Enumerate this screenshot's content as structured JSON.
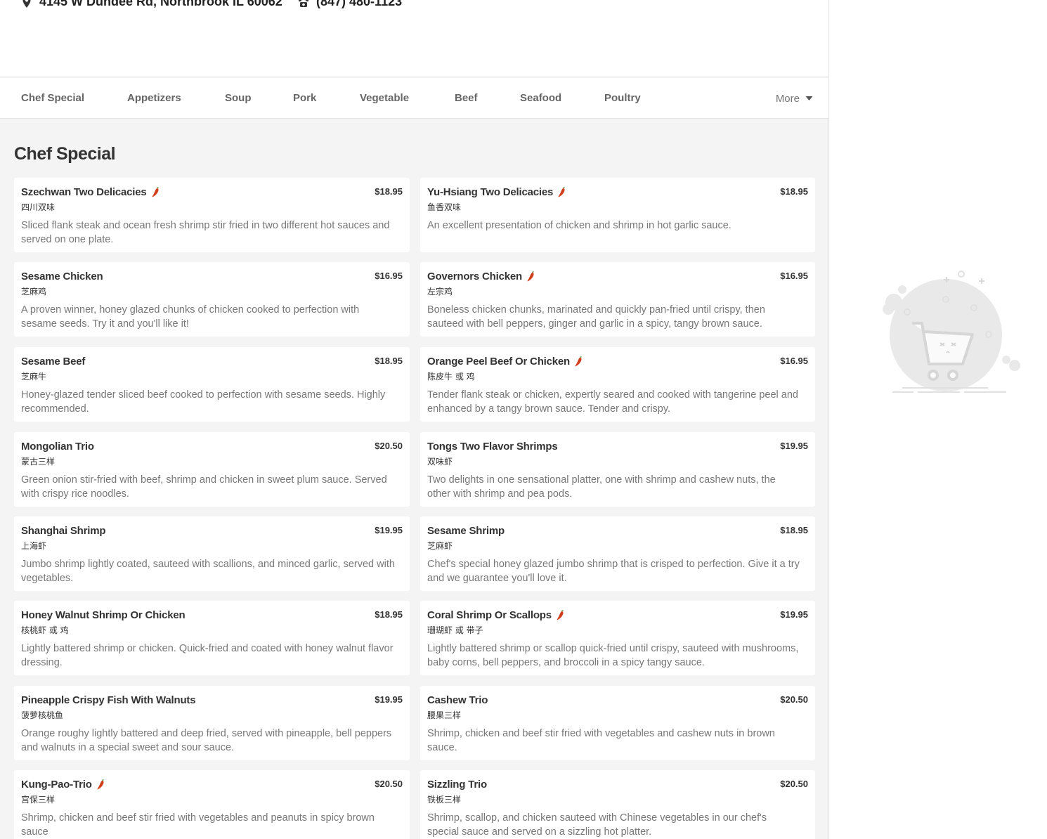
{
  "restaurant": {
    "address": "4145 W Dundee Rd, Northbrook IL 60062",
    "phone": "(847) 480-1123"
  },
  "nav": {
    "items": [
      "Chef Special",
      "Appetizers",
      "Soup",
      "Pork",
      "Vegetable",
      "Beef",
      "Seafood",
      "Poultry"
    ],
    "more_label": "More"
  },
  "section": {
    "title": "Chef Special"
  },
  "menu": [
    {
      "name": "Szechwan Two Delicacies",
      "cn": "四川双味",
      "price": "$18.95",
      "spicy": true,
      "desc": "Sliced flank steak and ocean fresh shrimp stir fried in two different hot sauces and served on one plate."
    },
    {
      "name": "Yu-Hsiang Two Delicacies",
      "cn": "鱼香双味",
      "price": "$18.95",
      "spicy": true,
      "desc": "An excellent presentation of chicken and shrimp in hot garlic sauce."
    },
    {
      "name": "Sesame Chicken",
      "cn": "芝麻鸡",
      "price": "$16.95",
      "spicy": false,
      "desc": "A proven winner, honey glazed chunks of chicken cooked to perfection with sesame seeds. Try it and you'll like it!"
    },
    {
      "name": "Governors Chicken",
      "cn": "左宗鸡",
      "price": "$16.95",
      "spicy": true,
      "desc": "Boneless chicken chunks, marinated and quickly pan-fried until crispy, then sauteed with bell peppers, ginger and garlic in a spicy, tangy brown sauce."
    },
    {
      "name": "Sesame Beef",
      "cn": "芝麻牛",
      "price": "$18.95",
      "spicy": false,
      "desc": "Honey-glazed tender sliced beef cooked to perfection with sesame seeds. Highly recommended."
    },
    {
      "name": "Orange Peel Beef Or Chicken",
      "cn": "陈皮牛 或 鸡",
      "price": "$16.95",
      "spicy": true,
      "desc": "Tender flank steak or chicken, expertly seared and cooked with tangerine peel and enhanced by a tangy brown sauce. Tender and crispy."
    },
    {
      "name": "Mongolian Trio",
      "cn": "蒙古三样",
      "price": "$20.50",
      "spicy": false,
      "desc": "Green onion stir-fried with beef, shrimp and chicken in sweet plum sauce. Served with crispy rice noodles."
    },
    {
      "name": "Tongs Two Flavor Shrimps",
      "cn": "双味虾",
      "price": "$19.95",
      "spicy": false,
      "desc": "Two delights in one sensational platter, one with shrimp and cashew nuts, the other with shrimp and pea pods."
    },
    {
      "name": "Shanghai Shrimp",
      "cn": "上海虾",
      "price": "$19.95",
      "spicy": false,
      "desc": "Jumbo shrimp lightly coated, sauteed with scallions, and minced garlic, served with vegetables."
    },
    {
      "name": "Sesame Shrimp",
      "cn": "芝麻虾",
      "price": "$18.95",
      "spicy": false,
      "desc": "Chef's special honey glazed jumbo shrimp that is crisped to perfection. Give it a try and we guarantee you'll love it."
    },
    {
      "name": "Honey Walnut Shrimp Or Chicken",
      "cn": "核桃虾 或 鸡",
      "price": "$18.95",
      "spicy": false,
      "desc": "Lightly battered shrimp or chicken. Quick-fried and coated with honey walnut flavor dressing."
    },
    {
      "name": "Coral Shrimp Or Scallops",
      "cn": "珊瑚虾 或 带子",
      "price": "$19.95",
      "spicy": true,
      "desc": "Lightly battered shrimp or scallop quick-fried until crispy, sauteed with mushrooms, baby corns, bell peppers, and broccoli in a spicy tangy sauce."
    },
    {
      "name": "Pineapple Crispy Fish With Walnuts",
      "cn": "菠萝核桃鱼",
      "price": "$19.95",
      "spicy": false,
      "desc": "Orange roughy lightly battered and deep fried, served with pineapple, bell peppers and walnuts in a special sweet and sour sauce."
    },
    {
      "name": "Cashew Trio",
      "cn": "腰果三样",
      "price": "$20.50",
      "spicy": false,
      "desc": "Shrimp, chicken and beef stir fried with vegetables and cashew nuts in brown sauce."
    },
    {
      "name": "Kung-Pao-Trio",
      "cn": "宫保三样",
      "price": "$20.50",
      "spicy": true,
      "desc": "Shrimp, chicken and beef stir fried with vegetables and peanuts in spicy brown sauce"
    },
    {
      "name": "Sizzling Trio",
      "cn": "铁板三样",
      "price": "$20.50",
      "spicy": false,
      "desc": "Shrimp, scallop, and chicken sauteed with Chinese vegetables in our chef's special sauce and served on a sizzling hot platter."
    }
  ],
  "icons": {
    "location": "location-pin-icon",
    "phone": "phone-icon",
    "spicy": "chili-pepper-icon",
    "more": "caret-down-icon",
    "cart": "empty-cart-illustration"
  },
  "colors": {
    "spicy": "#d0401e",
    "background": "#f4f4f4",
    "card": "#ffffff",
    "muted_text": "#777777"
  }
}
